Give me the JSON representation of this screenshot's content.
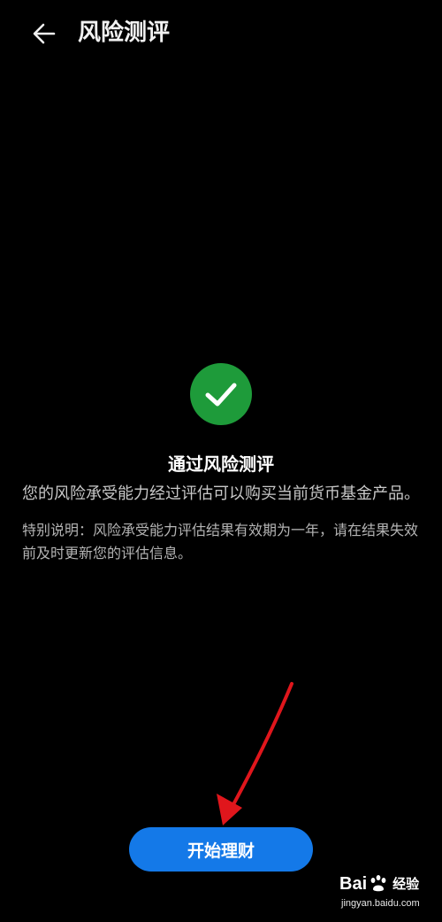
{
  "header": {
    "back_icon": "arrow-left-icon",
    "title": "风险测评"
  },
  "result": {
    "icon": "check-circle-icon",
    "title": "通过风险测评",
    "description": "您的风险承受能力经过评估可以购买当前货币基金产品。",
    "note": "特别说明：风险承受能力评估结果有效期为一年，请在结果失效前及时更新您的评估信息。"
  },
  "action": {
    "start_label": "开始理财"
  },
  "watermark": {
    "logo_left": "Bai",
    "logo_right": "经验",
    "url": "jingyan.baidu.com"
  },
  "colors": {
    "background": "#000000",
    "success_green": "#1e9b3a",
    "button_blue": "#1479e8",
    "annotation_red": "#e0161c"
  }
}
